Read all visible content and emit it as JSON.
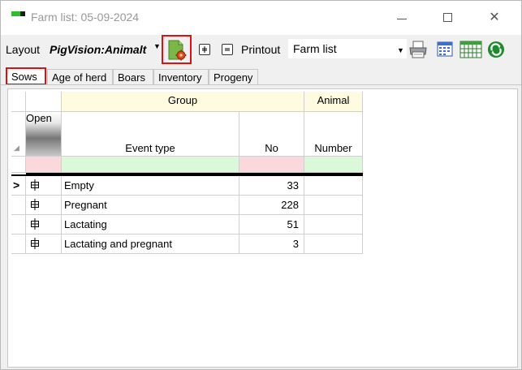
{
  "window": {
    "title": "Farm list: 05-09-2024",
    "minimize": "—",
    "close": "✕"
  },
  "toolbar": {
    "layout_label": "Layout",
    "layout_value": "PigVision:Animalt",
    "dropdown_arrow": "▼",
    "printout_label": "Printout",
    "printout_value": "Farm list"
  },
  "tabs": [
    {
      "label": "Sows",
      "active": true
    },
    {
      "label": "Age of herd"
    },
    {
      "label": "Boars"
    },
    {
      "label": "Inventory"
    },
    {
      "label": "Progeny"
    }
  ],
  "grid": {
    "group_headers": [
      "Group",
      "Animal"
    ],
    "columns": [
      "Open",
      "Event type",
      "No",
      "Number"
    ],
    "current_row_indicator": ">",
    "rows": [
      {
        "event_type": "Empty",
        "no": "33",
        "number": ""
      },
      {
        "event_type": "Pregnant",
        "no": "228",
        "number": ""
      },
      {
        "event_type": "Lactating",
        "no": "51",
        "number": ""
      },
      {
        "event_type": "Lactating and pregnant",
        "no": "3",
        "number": ""
      }
    ]
  },
  "colors": {
    "highlight_border": "#e01010",
    "group_header_bg": "#fffbe0",
    "filter_pink": "#fad8dc",
    "filter_green": "#d9f9d8"
  }
}
